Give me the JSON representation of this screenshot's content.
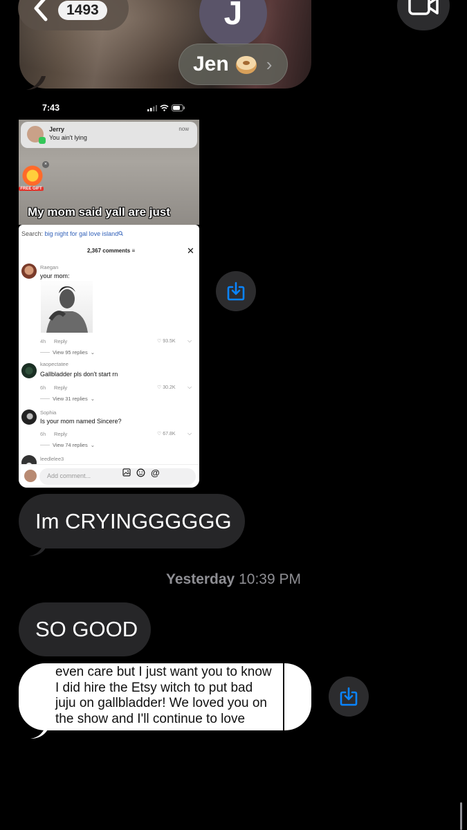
{
  "header": {
    "unread_count": "1493",
    "avatar_initial": "J",
    "contact_name": "Jen",
    "contact_emoji": "bagel-emoji",
    "back_icon": "chevron-left-icon",
    "video_icon": "video-camera-icon"
  },
  "screenshot": {
    "status_time": "7:43",
    "notification": {
      "sender": "Jerry",
      "message": "You ain't lying",
      "time": "now"
    },
    "gift_label": "FREE GIFT",
    "caption": "My mom said yall are just",
    "search_label": "Search:",
    "search_query": "big night for gal love island",
    "comments_count": "2,367 comments",
    "comments": [
      {
        "user": "Raegan",
        "text": "your mom:",
        "age": "4h",
        "reply": "Reply",
        "likes": "93.5K",
        "view_replies": "View 95 replies"
      },
      {
        "user": "kaopectatee",
        "text": "Gallbladder pls don't start rn",
        "age": "6h",
        "reply": "Reply",
        "likes": "30.2K",
        "view_replies": "View 31 replies"
      },
      {
        "user": "Sophia",
        "text": "Is your mom named Sincere?",
        "age": "6h",
        "reply": "Reply",
        "likes": "67.8K",
        "view_replies": "View 74 replies"
      },
      {
        "user": "leedlelee3"
      }
    ],
    "add_comment_placeholder": "Add comment..."
  },
  "messages": [
    {
      "text": "Im CRYINGGGGGG"
    },
    {
      "text": "SO GOOD"
    }
  ],
  "timestamp": {
    "day": "Yesterday",
    "time": "10:39 PM"
  },
  "quoted_message": {
    "lines": [
      "even care but I just want you to know",
      "I did hire the Etsy witch to put bad",
      "juju on gallbladder! We loved you on",
      "the show and I'll continue to love"
    ]
  },
  "colors": {
    "accent": "#0a84ff",
    "bubble_gray": "#262628",
    "background": "#000000"
  }
}
